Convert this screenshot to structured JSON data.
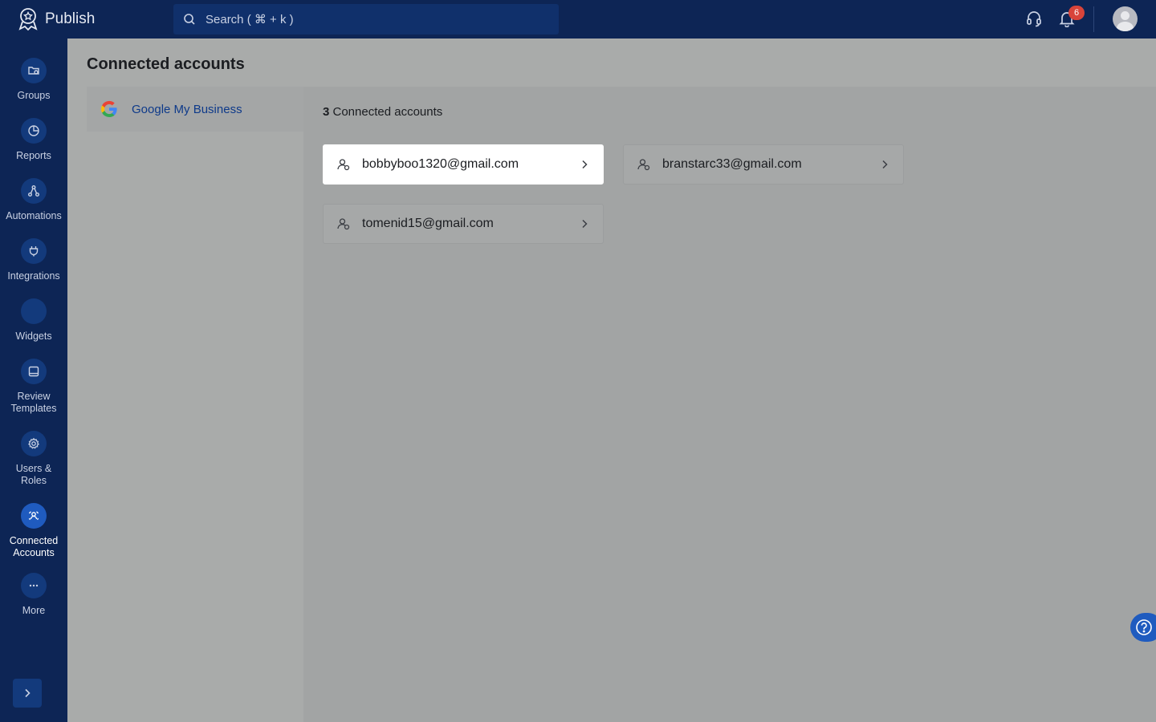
{
  "app": {
    "name": "Publish"
  },
  "search": {
    "placeholder": "Search ( ⌘ + k )"
  },
  "header": {
    "notification_count": "6"
  },
  "sidebar": {
    "items": [
      {
        "label": "Groups",
        "icon": "groups-icon"
      },
      {
        "label": "Reports",
        "icon": "reports-icon"
      },
      {
        "label": "Automations",
        "icon": "automations-icon"
      },
      {
        "label": "Integrations",
        "icon": "integrations-icon"
      },
      {
        "label": "Widgets",
        "icon": "widgets-icon"
      },
      {
        "label": "Review Templates",
        "icon": "review-templates-icon"
      },
      {
        "label": "Users & Roles",
        "icon": "gear-icon"
      },
      {
        "label": "Connected Accounts",
        "icon": "connected-accounts-icon",
        "active": true
      },
      {
        "label": "More",
        "icon": "more-icon"
      }
    ]
  },
  "page": {
    "title": "Connected accounts"
  },
  "providers": [
    {
      "label": "Google My Business",
      "icon": "google-icon"
    }
  ],
  "accounts_summary": {
    "count": "3",
    "label": " Connected accounts"
  },
  "accounts": [
    {
      "email": "bobbyboo1320@gmail.com",
      "highlighted": true
    },
    {
      "email": "branstarc33@gmail.com"
    },
    {
      "email": "tomenid15@gmail.com"
    }
  ],
  "colors": {
    "topbar": "#0d2555",
    "accent": "#1f5bbf",
    "badge": "#d8443a",
    "link": "#0e3a8a"
  }
}
